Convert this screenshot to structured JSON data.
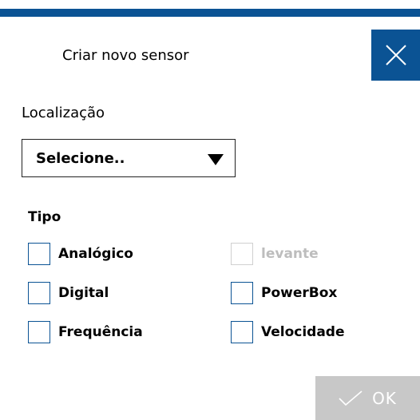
{
  "dialog": {
    "title": "Criar novo sensor",
    "close_icon": "close-icon"
  },
  "location": {
    "label": "Localização",
    "selected_value": "Selecione..",
    "dropdown_icon": "triangle-down-icon"
  },
  "type": {
    "label": "Tipo",
    "options": [
      {
        "label": "Analógico",
        "checked": false,
        "enabled": true
      },
      {
        "label": "levante",
        "checked": false,
        "enabled": false
      },
      {
        "label": "Digital",
        "checked": false,
        "enabled": true
      },
      {
        "label": "PowerBox",
        "checked": false,
        "enabled": true
      },
      {
        "label": "Frequência",
        "checked": false,
        "enabled": true
      },
      {
        "label": "Velocidade",
        "checked": false,
        "enabled": true
      }
    ]
  },
  "ok_button": {
    "label": "OK",
    "icon": "check-icon",
    "enabled": false
  },
  "colors": {
    "accent": "#0b5394",
    "disabled_button": "#c8c8c8",
    "disabled_text": "#bdbdbd"
  }
}
